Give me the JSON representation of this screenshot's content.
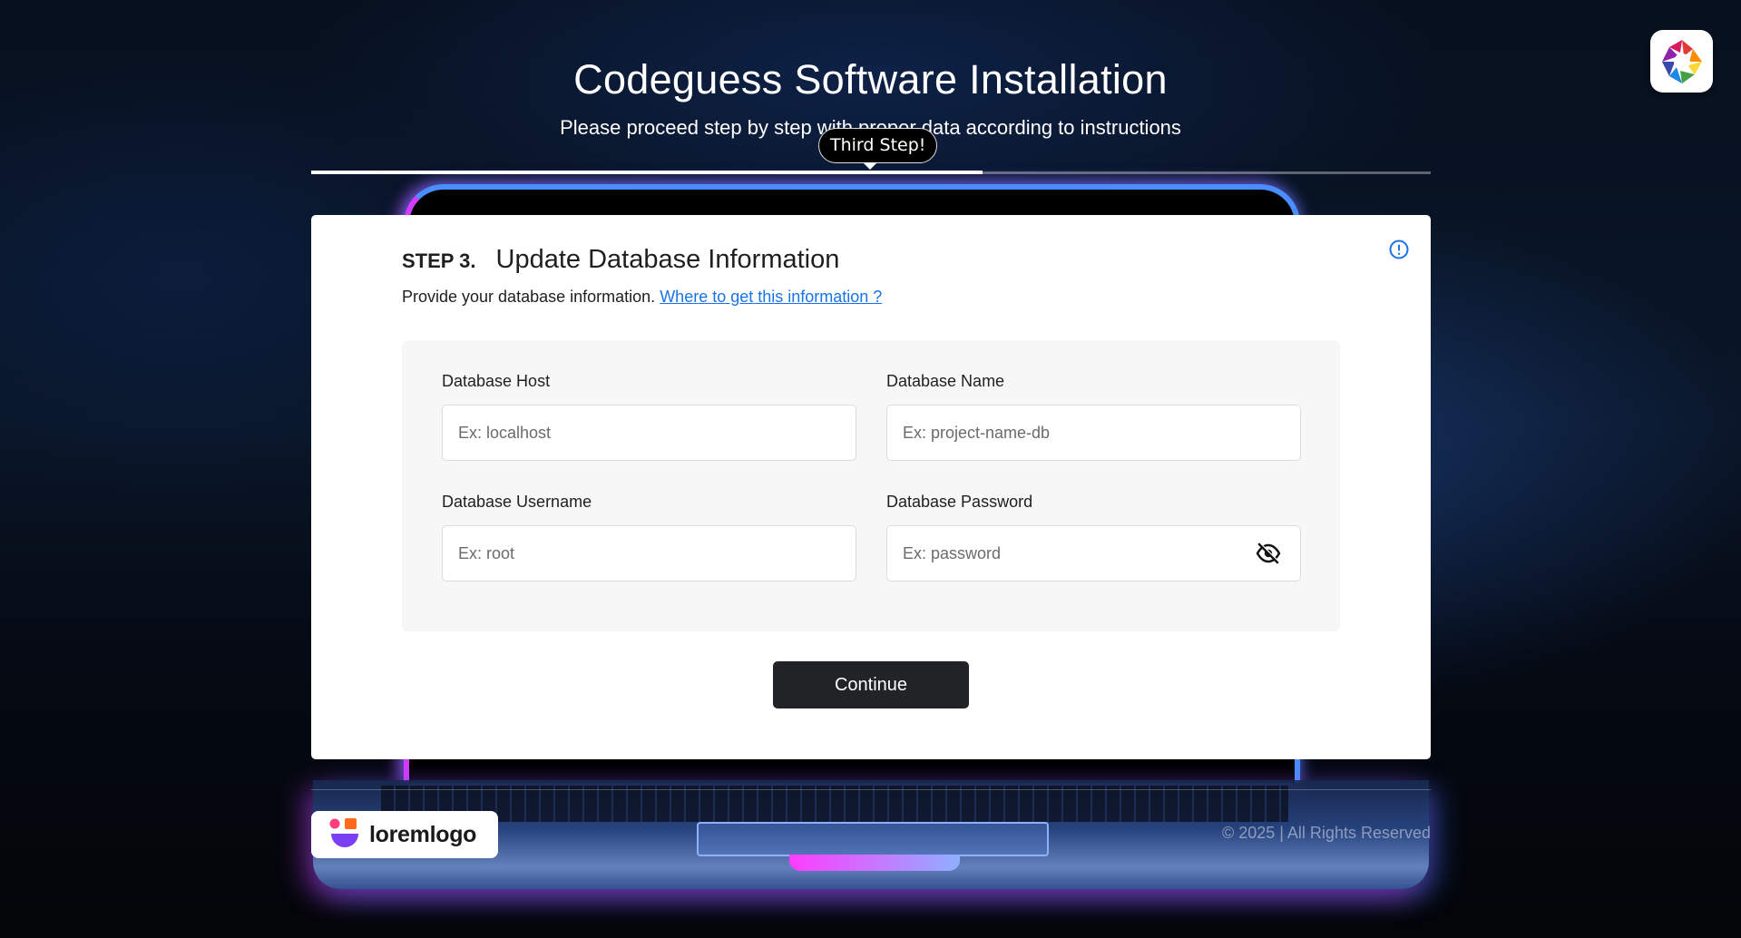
{
  "header": {
    "title": "Codeguess Software Installation",
    "subtitle": "Please proceed step by step with proper data according to instructions"
  },
  "progress": {
    "tooltip": "Third Step!",
    "fraction": 0.6
  },
  "step": {
    "number": "STEP 3.",
    "title": "Update Database Information",
    "description": "Provide your database information.",
    "help_link": "Where to get this information ?"
  },
  "form": {
    "host": {
      "label": "Database Host",
      "placeholder": "Ex: localhost",
      "value": ""
    },
    "name": {
      "label": "Database Name",
      "placeholder": "Ex: project-name-db",
      "value": ""
    },
    "username": {
      "label": "Database Username",
      "placeholder": "Ex: root",
      "value": ""
    },
    "password": {
      "label": "Database Password",
      "placeholder": "Ex: password",
      "value": ""
    }
  },
  "actions": {
    "continue_label": "Continue"
  },
  "footer": {
    "logo_text": "loremlogo",
    "copyright": "© 2025 | All Rights Reserved"
  },
  "icons": {
    "app": "app-logo-icon",
    "info": "info-icon",
    "toggle_password": "eye-off-icon"
  },
  "colors": {
    "link": "#1a73e8",
    "button": "#212326",
    "info_icon": "#1a73e8"
  }
}
